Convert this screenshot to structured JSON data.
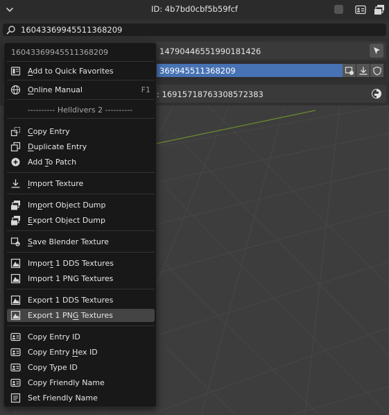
{
  "header": {
    "id_label": "ID: 4b7bd0cbf5b59fcf"
  },
  "search": {
    "value": "16043369945511368209"
  },
  "panel": {
    "row1_text": "14790446551990181426",
    "row2_value": "369945511368209",
    "row3_text": ": 16915718763308572383"
  },
  "menu": {
    "title": "16043369945511368209",
    "section_header": "---------- Helldivers 2 ----------",
    "online_manual_shortcut": "F1",
    "items": [
      {
        "name": "add-to-quick-favorites",
        "pre": "",
        "u": "A",
        "post": "dd to Quick Favorites",
        "icon": "quick-favorites-icon"
      },
      {
        "name": "online-manual",
        "pre": "",
        "u": "O",
        "post": "nline Manual",
        "icon": "globe-icon"
      },
      {
        "name": "copy-entry",
        "pre": "",
        "u": "C",
        "post": "opy Entry",
        "icon": "copy-entry-icon"
      },
      {
        "name": "duplicate-entry",
        "pre": "",
        "u": "D",
        "post": "uplicate Entry",
        "icon": "duplicate-icon"
      },
      {
        "name": "add-to-patch",
        "pre": "Add ",
        "u": "T",
        "post": "o Patch",
        "icon": "add-circle-icon"
      },
      {
        "name": "import-texture",
        "pre": "",
        "u": "I",
        "post": "mport Texture",
        "icon": "import-icon"
      },
      {
        "name": "import-object-dump",
        "pre": "Im",
        "u": "p",
        "post": "ort Object Dump",
        "icon": "object-dump-icon"
      },
      {
        "name": "export-object-dump",
        "pre": "",
        "u": "E",
        "post": "xport Object Dump",
        "icon": "object-dump-icon"
      },
      {
        "name": "save-blender-texture",
        "pre": "",
        "u": "S",
        "post": "ave Blender Texture",
        "icon": "save-texture-icon"
      },
      {
        "name": "import-dds-textures",
        "pre": "Impor",
        "u": "t",
        "post": " 1 DDS Textures",
        "icon": "image-icon"
      },
      {
        "name": "import-png-textures",
        "pre": "Import 1 PNG Textures",
        "u": "",
        "post": "",
        "icon": "image-icon"
      },
      {
        "name": "export-dds-textures",
        "pre": "Export 1 DDS Textures",
        "u": "",
        "post": "",
        "icon": "image-icon"
      },
      {
        "name": "export-png-textures",
        "pre": "Export 1 PN",
        "u": "G",
        "post": " Textures",
        "icon": "image-icon"
      },
      {
        "name": "copy-entry-id",
        "pre": "Copy Entry ID",
        "u": "",
        "post": "",
        "icon": "id-card-icon"
      },
      {
        "name": "copy-entry-hex-id",
        "pre": "Copy Entry ",
        "u": "H",
        "post": "ex ID",
        "icon": "id-card-icon"
      },
      {
        "name": "copy-type-id",
        "pre": "Copy Type ID",
        "u": "",
        "post": "",
        "icon": "id-card-icon"
      },
      {
        "name": "copy-friendly-name",
        "pre": "Copy Friendly Name",
        "u": "",
        "post": "",
        "icon": "id-card-icon"
      },
      {
        "name": "set-friendly-name",
        "pre": "Set Friendly Name",
        "u": "",
        "post": "",
        "icon": "text-lines-icon"
      }
    ]
  },
  "colors": {
    "accent": "#4772b3",
    "menu_bg": "#181818",
    "highlight": "#444444",
    "viewport_bg": "#3d3d3d",
    "grid_line": "#4a4a4a",
    "axis_line": "#6b8a2e"
  }
}
